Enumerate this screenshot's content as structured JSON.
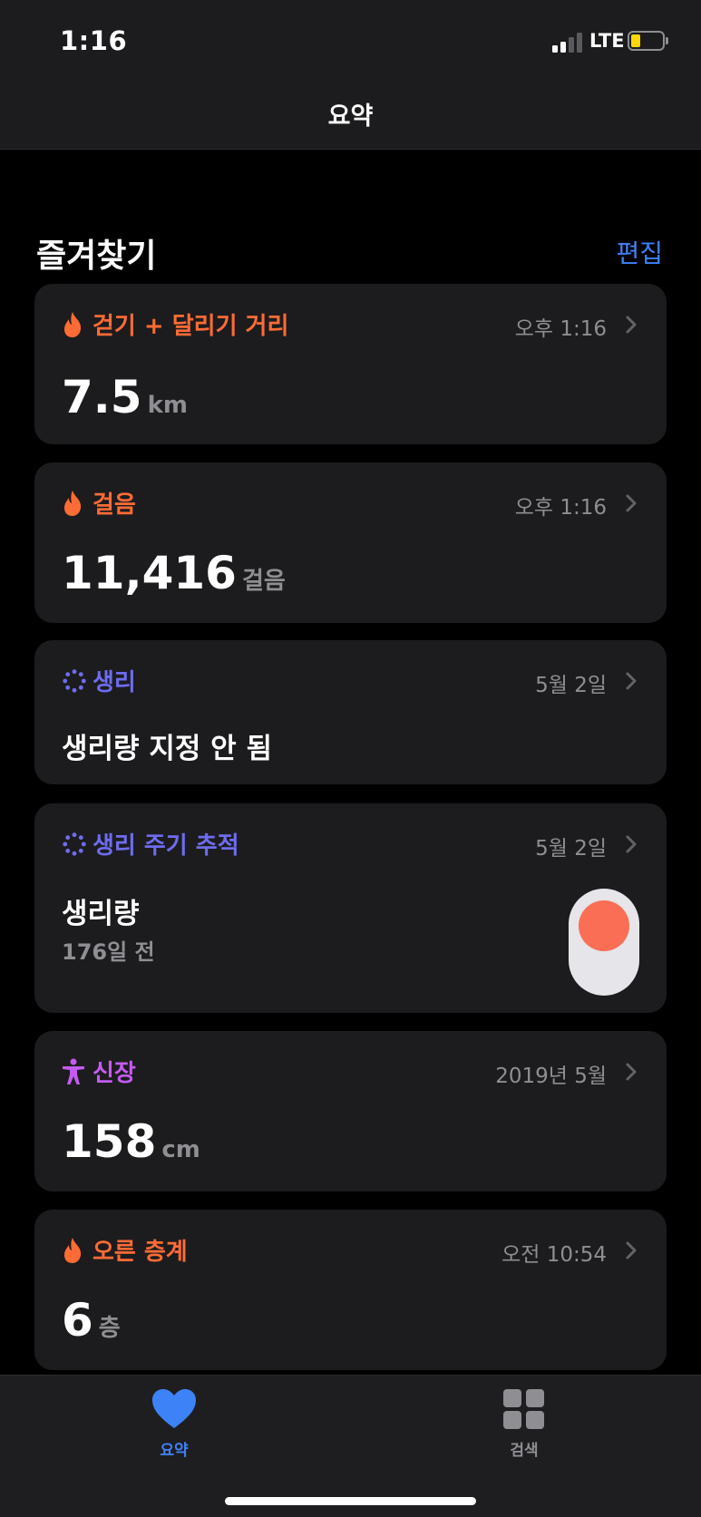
{
  "status_bar": {
    "time": "1:16",
    "network": "LTE",
    "battery_color": "#ffd60a"
  },
  "nav": {
    "title": "요약"
  },
  "favorites": {
    "title": "즐겨찾기",
    "edit_label": "편집",
    "cards": [
      {
        "title": "걷기 + 달리기 거리",
        "time": "오후 1:16",
        "value": "7.5",
        "unit": "km",
        "icon": "flame-icon",
        "color": "#ff6b35"
      },
      {
        "title": "걸음",
        "time": "오후 1:16",
        "value": "11,416",
        "unit": "걸음",
        "icon": "flame-icon",
        "color": "#ff6b35"
      },
      {
        "title": "생리",
        "time": "5월 2일",
        "value": "생리량 지정 안 됨",
        "icon": "cycle-icon",
        "color": "#6e6cf0"
      },
      {
        "title": "생리 주기 추적",
        "time": "5월 2일",
        "value": "생리량",
        "subvalue": "176일 전",
        "icon": "cycle-icon",
        "color": "#6e6cf0"
      },
      {
        "title": "신장",
        "time": "2019년 5월",
        "value": "158",
        "unit": "cm",
        "icon": "figure-icon",
        "color": "#c45bf0"
      },
      {
        "title": "오른 층계",
        "time": "오전 10:54",
        "value": "6",
        "unit": "층",
        "icon": "flame-icon",
        "color": "#ff6b35"
      }
    ]
  },
  "tab_bar": {
    "tabs": [
      {
        "label": "요약",
        "icon": "heart-icon",
        "active": true,
        "color": "#3e82f7"
      },
      {
        "label": "검색",
        "icon": "grid-icon",
        "active": false,
        "color": "#8e8e93"
      }
    ]
  }
}
